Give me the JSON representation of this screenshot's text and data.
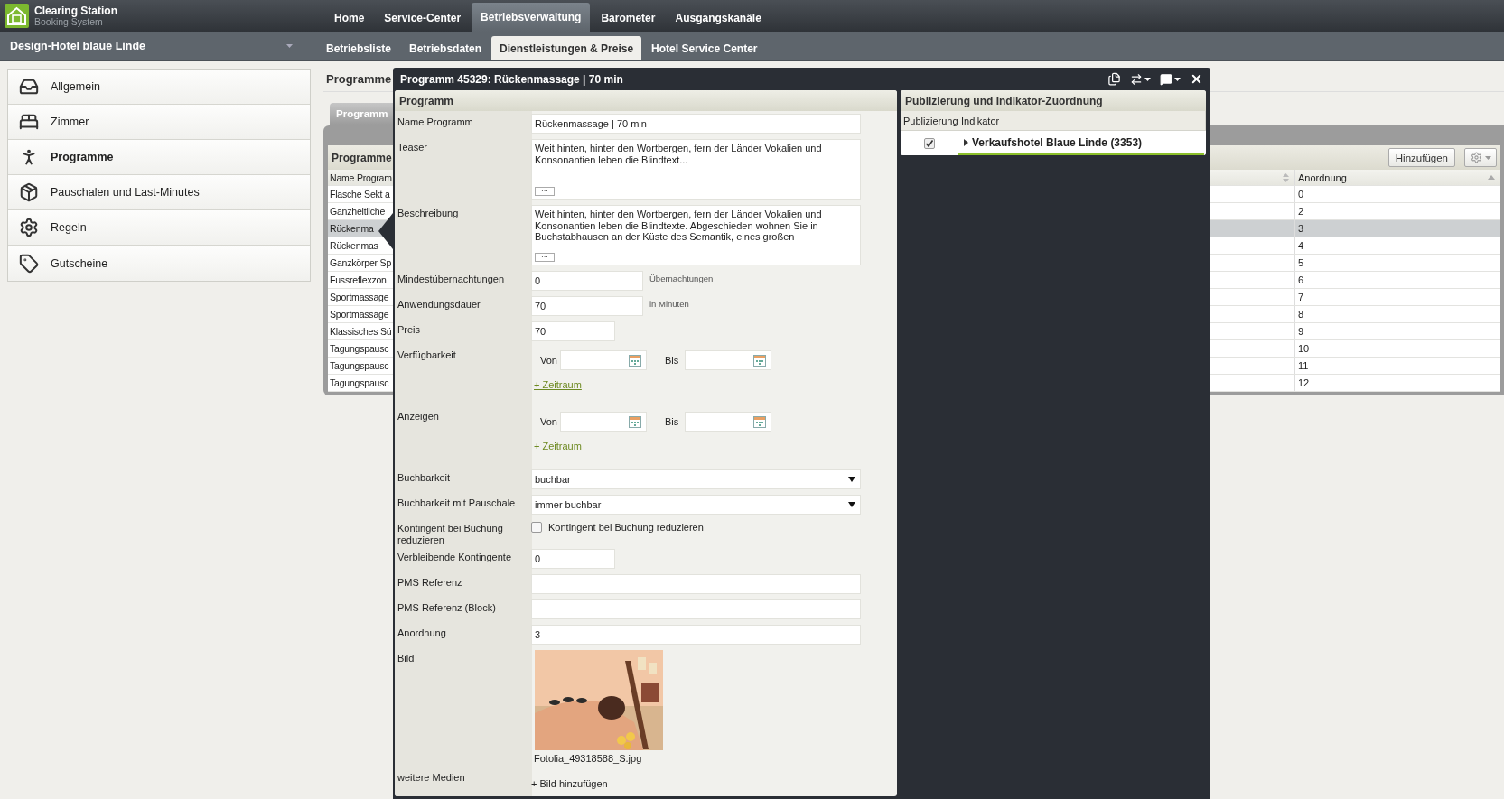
{
  "app": {
    "name": "Clearing Station",
    "subtitle": "Booking System"
  },
  "main_nav": [
    {
      "label": "Home",
      "selected": false
    },
    {
      "label": "Service-Center",
      "selected": false
    },
    {
      "label": "Betriebsverwaltung",
      "selected": true
    },
    {
      "label": "Barometer",
      "selected": false
    },
    {
      "label": "Ausgangskanäle",
      "selected": false
    }
  ],
  "hotel_selector": {
    "value": "Design-Hotel blaue Linde"
  },
  "sub_nav": [
    {
      "label": "Betriebsliste",
      "selected": false
    },
    {
      "label": "Betriebsdaten",
      "selected": false
    },
    {
      "label": "Dienstleistungen & Preise",
      "selected": true
    },
    {
      "label": "Hotel Service Center",
      "selected": false
    }
  ],
  "sidebar": {
    "items": [
      {
        "label": "Allgemein",
        "selected": false
      },
      {
        "label": "Zimmer",
        "selected": false
      },
      {
        "label": "Programme",
        "selected": true
      },
      {
        "label": "Pauschalen und Last-Minutes",
        "selected": false
      },
      {
        "label": "Regeln",
        "selected": false
      },
      {
        "label": "Gutscheine",
        "selected": false
      }
    ]
  },
  "page_title": "Programme",
  "grid": {
    "tab": "Programm",
    "title": "Programme",
    "add_button": "Hinzufügen",
    "columns": [
      "Name Program",
      "Anordnung"
    ],
    "rows": [
      {
        "name": "Flasche Sekt a",
        "order": "0",
        "selected": false
      },
      {
        "name": "Ganzheitliche",
        "order": "2",
        "selected": false
      },
      {
        "name": "Rückenma",
        "order": "3",
        "selected": true
      },
      {
        "name": "Rückenmas",
        "order": "4",
        "selected": false
      },
      {
        "name": "Ganzkörper Sp",
        "order": "5",
        "selected": false
      },
      {
        "name": "Fussreflexzon",
        "order": "6",
        "selected": false
      },
      {
        "name": "Sportmassage",
        "order": "7",
        "selected": false
      },
      {
        "name": "Sportmassage",
        "order": "8",
        "selected": false
      },
      {
        "name": "Klassisches Sü",
        "order": "9",
        "selected": false
      },
      {
        "name": "Tagungspausc",
        "order": "10",
        "selected": false
      },
      {
        "name": "Tagungspausc",
        "order": "11",
        "selected": false
      },
      {
        "name": "Tagungspausc",
        "order": "12",
        "selected": false
      }
    ]
  },
  "modal": {
    "title": "Programm 45329: Rückenmassage | 70 min",
    "form": {
      "title": "Programm",
      "fields": [
        {
          "kind": "text",
          "label": "Name Programm",
          "value": "Rückenmassage | 70 min"
        },
        {
          "kind": "textarea",
          "label": "Teaser",
          "value": "Weit hinten, hinter den Wortbergen, fern der Länder Vokalien und Konsonantien leben die Blindtext...",
          "expand_button": "···"
        },
        {
          "kind": "textarea",
          "label": "Beschreibung",
          "value": "Weit hinten, hinter den Wortbergen, fern der Länder Vokalien und Konsonantien leben die Blindtexte. Abgeschieden wohnen Sie in Buchstabhausen an der Küste des Semantik, eines großen",
          "expand_button": "···"
        },
        {
          "kind": "number",
          "label": "Mindestübernachtungen",
          "value": "0",
          "unit": "Übernachtungen"
        },
        {
          "kind": "number",
          "label": "Anwendungsdauer",
          "value": "70",
          "unit": "in Minuten"
        },
        {
          "kind": "number",
          "label": "Preis",
          "value": "70"
        },
        {
          "kind": "daterange",
          "label": "Verfügbarkeit",
          "from_label": "Von",
          "to_label": "Bis",
          "link": "+ Zeitraum"
        },
        {
          "kind": "daterange",
          "label": "Anzeigen",
          "from_label": "Von",
          "to_label": "Bis",
          "link": "+ Zeitraum"
        },
        {
          "kind": "select",
          "label": "Buchbarkeit",
          "value": "buchbar"
        },
        {
          "kind": "select",
          "label": "Buchbarkeit mit Pauschale",
          "value": "immer buchbar"
        },
        {
          "kind": "checkbox",
          "label": "Kontingent bei Buchung reduzieren",
          "text": "Kontingent bei Buchung reduzieren",
          "checked": false
        },
        {
          "kind": "number",
          "label": "Verbleibende Kontingente",
          "value": "0"
        },
        {
          "kind": "text",
          "label": "PMS Referenz"
        },
        {
          "kind": "text",
          "label": "PMS Referenz (Block)"
        },
        {
          "kind": "text",
          "label": "Anordnung",
          "value": "3"
        },
        {
          "label": "Bild",
          "filename": "Fotolia_49318588_S.jpg"
        },
        {
          "kind": "link",
          "label": "weitere Medien",
          "link": "+ Bild hinzufügen"
        }
      ]
    },
    "publishing": {
      "title": "Publizierung und Indikator-Zuordnung",
      "columns": [
        "Publizierung",
        "Indikator"
      ],
      "rows": [
        {
          "published": true,
          "label": "Verkaufshotel Blaue Linde (3353)",
          "expanded": false
        }
      ]
    }
  }
}
